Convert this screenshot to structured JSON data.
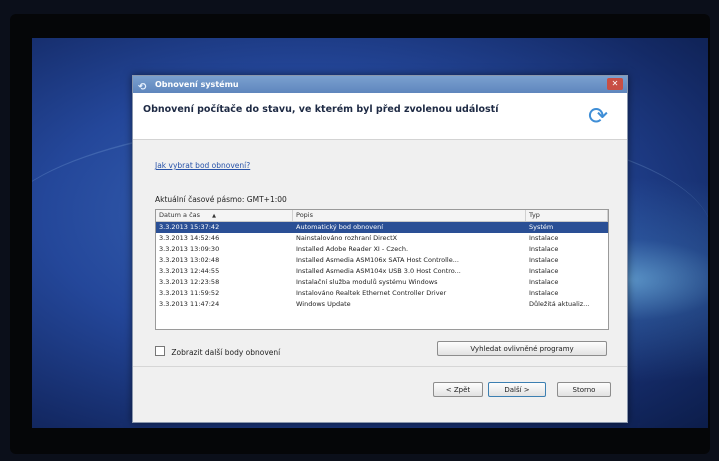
{
  "dialog": {
    "title": "Obnovení systému",
    "heading": "Obnovení počítače do stavu, ve kterém byl před zvolenou událostí",
    "help_link": "Jak vybrat bod obnovení?",
    "timezone": "Aktuální časové pásmo: GMT+1:00",
    "icons": {
      "title": "system-restore-icon",
      "header": "restore-icon",
      "close": "close-icon"
    },
    "table": {
      "columns": [
        "Datum a čas",
        "Popis",
        "Typ"
      ],
      "sort_indicator": "▲",
      "rows": [
        [
          "3.3.2013 15:37:42",
          "Automatický bod obnovení",
          "Systém"
        ],
        [
          "3.3.2013 14:52:46",
          "Nainstalováno rozhraní DirectX",
          "Instalace"
        ],
        [
          "3.3.2013 13:09:30",
          "Installed Adobe Reader XI - Czech.",
          "Instalace"
        ],
        [
          "3.3.2013 13:02:48",
          "Installed Asmedia ASM106x SATA Host Controlle...",
          "Instalace"
        ],
        [
          "3.3.2013 12:44:55",
          "Installed Asmedia ASM104x USB 3.0 Host Contro...",
          "Instalace"
        ],
        [
          "3.3.2013 12:23:58",
          "Instalační služba modulů systému Windows",
          "Instalace"
        ],
        [
          "3.3.2013 11:59:52",
          "Instalováno Realtek Ethernet Controller Driver",
          "Instalace"
        ],
        [
          "3.3.2013 11:47:24",
          "Windows Update",
          "Důležitá aktualiz..."
        ]
      ],
      "selected_index": 0
    },
    "show_more_label": "Zobrazit další body obnovení",
    "scan_button": "Vyhledat ovlivněné programy",
    "back_button": "< Zpět",
    "next_button": "Další >",
    "cancel_button": "Storno"
  },
  "colors": {
    "selection": "#2a4f95",
    "caption": "#e41b1b"
  }
}
